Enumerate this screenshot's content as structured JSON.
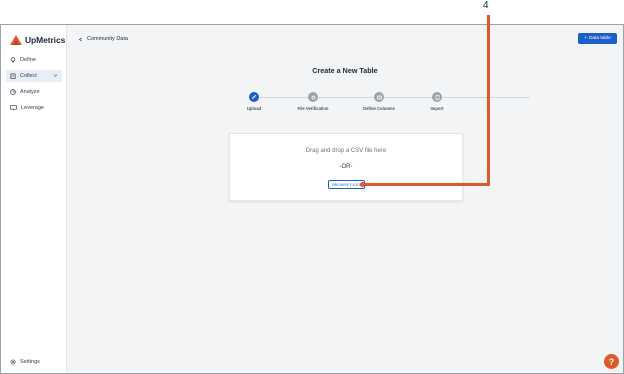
{
  "callout": {
    "number": "4"
  },
  "sidebar": {
    "brand": "UpMetrics",
    "items": [
      {
        "label": "Define",
        "icon": "lightbulb-icon"
      },
      {
        "label": "Collect",
        "icon": "clipboard-icon",
        "active": true
      },
      {
        "label": "Analyze",
        "icon": "chart-pie-icon"
      },
      {
        "label": "Leverage",
        "icon": "presentation-icon"
      }
    ],
    "settings_label": "Settings"
  },
  "header": {
    "breadcrumb": "Community Data",
    "add_button": "Data table"
  },
  "main": {
    "title": "Create a New Table",
    "steps": [
      {
        "label": "Upload",
        "active": true
      },
      {
        "label": "File Verification"
      },
      {
        "label": "Define Columns"
      },
      {
        "label": "Import"
      }
    ],
    "upload": {
      "drag_text": "Drag and drop a CSV file here",
      "or_text": "-OR-",
      "browse_label": "BROWSE FILES"
    }
  },
  "help": {
    "label": "?"
  },
  "colors": {
    "accent": "#1d5fc9",
    "brand": "#dd5a2a"
  }
}
